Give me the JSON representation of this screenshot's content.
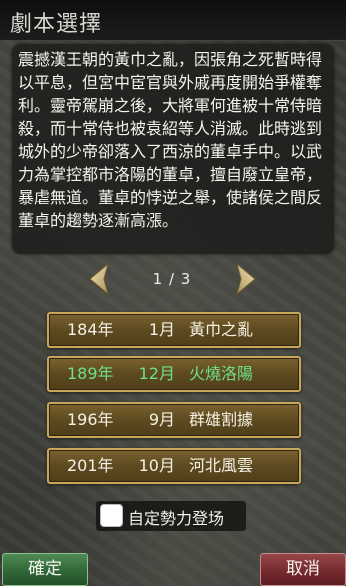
{
  "header": {
    "title": "劇本選擇"
  },
  "description": "震撼漢王朝的黃巾之亂，因張角之死暫時得以平息，但宮中宦官與外戚再度開始爭權奪利。靈帝駕崩之後，大將軍何進被十常侍暗殺，而十常侍也被袁紹等人消滅。此時逃到城外的少帝卻落入了西涼的董卓手中。以武力為掌控都市洛陽的董卓，擅自廢立皇帝，暴虐無道。董卓的悖逆之舉，使諸侯之間反董卓的趨勢逐漸高漲。",
  "pager": {
    "indicator": "1 / 3",
    "prev_icon": "left-arrow-icon",
    "next_icon": "right-arrow-icon"
  },
  "scenarios": [
    {
      "year": "184年",
      "month": "1月",
      "name": "黃巾之亂",
      "selected": false
    },
    {
      "year": "189年",
      "month": "12月",
      "name": "火燒洛陽",
      "selected": true
    },
    {
      "year": "196年",
      "month": "9月",
      "name": "群雄割據",
      "selected": false
    },
    {
      "year": "201年",
      "month": "10月",
      "name": "河北風雲",
      "selected": false
    }
  ],
  "custom_forces": {
    "label": "自定勢力登场",
    "checked": false
  },
  "buttons": {
    "ok": "確定",
    "cancel": "取消"
  },
  "colors": {
    "selected_text": "#6fe08a",
    "button_gold": "#c9a65a",
    "ok_green": "#2f6436",
    "cancel_red": "#73282d"
  }
}
